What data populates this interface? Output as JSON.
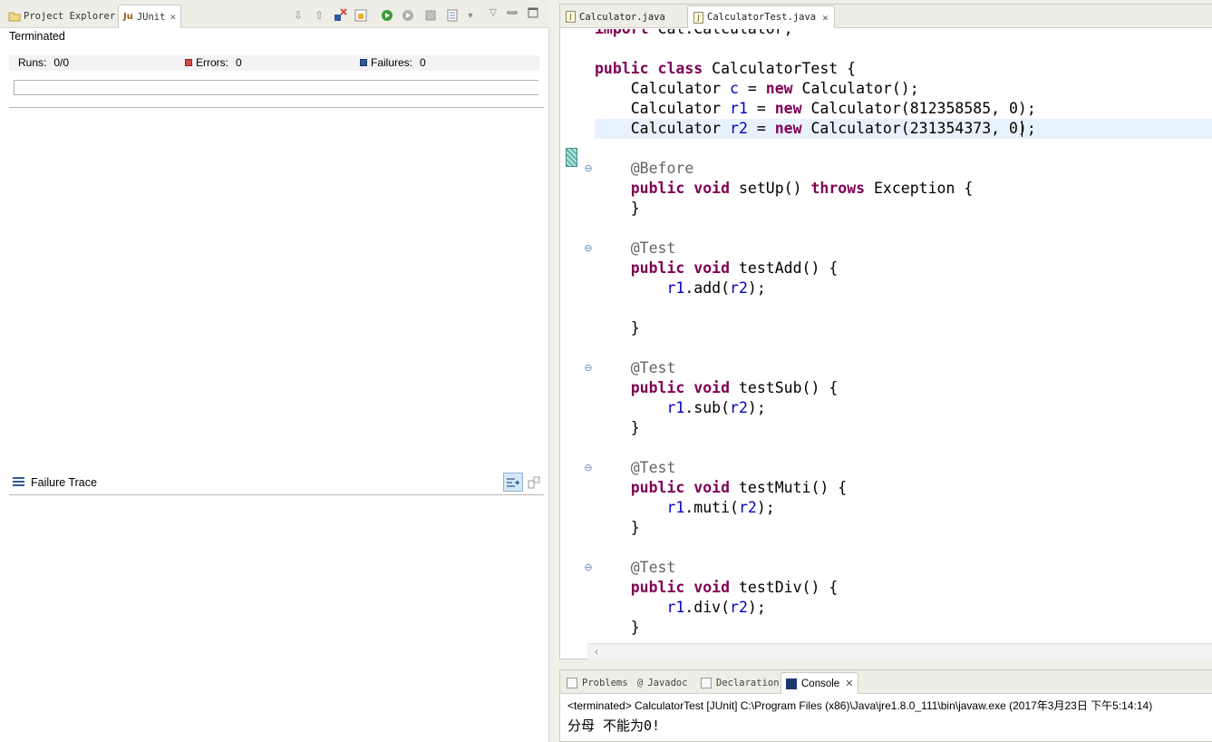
{
  "left_tabs": [
    {
      "label": "Project Explorer",
      "active": false
    },
    {
      "label": "JUnit",
      "active": true,
      "icon_text": "Ju"
    }
  ],
  "junit": {
    "status": "Terminated",
    "runs_label": "Runs:",
    "runs_value": "0/0",
    "errors_label": "Errors:",
    "errors_value": "0",
    "failures_label": "Failures:",
    "failures_value": "0",
    "failure_trace_label": "Failure Trace"
  },
  "editor_tabs": [
    {
      "label": "Calculator.java",
      "active": false
    },
    {
      "label": "CalculatorTest.java",
      "active": true
    }
  ],
  "code_lines": [
    "import Cal.Calculator;",
    "",
    "public class CalculatorTest {",
    "    Calculator c = new Calculator();",
    "    Calculator r1 = new Calculator(812358585, 0);",
    "    Calculator r2 = new Calculator(231354373, 0);",
    "",
    "    @Before",
    "    public void setUp() throws Exception {",
    "    }",
    "",
    "    @Test",
    "    public void testAdd() {",
    "        r1.add(r2);",
    "",
    "    }",
    "",
    "    @Test",
    "    public void testSub() {",
    "        r1.sub(r2);",
    "    }",
    "",
    "    @Test",
    "    public void testMuti() {",
    "        r1.muti(r2);",
    "    }",
    "",
    "    @Test",
    "    public void testDiv() {",
    "        r1.div(r2);",
    "    }"
  ],
  "console_tabs": [
    {
      "label": "Problems",
      "active": false
    },
    {
      "label": "Javadoc",
      "active": false,
      "prefix": "@"
    },
    {
      "label": "Declaration",
      "active": false
    },
    {
      "label": "Console",
      "active": true
    }
  ],
  "console": {
    "terminated_line": "<terminated> CalculatorTest [JUnit] C:\\Program Files (x86)\\Java\\jre1.8.0_111\\bin\\javaw.exe (2017年3月23日 下午5:14:14)",
    "output_line": "分母 不能为0!"
  },
  "colors": {
    "keyword": "#7f0055",
    "field": "#0000c0",
    "annotation": "#646464",
    "current_line": "#e8f2fe",
    "error_icon": "#d34a4a",
    "failure_icon": "#2c5a9a"
  },
  "icons": {
    "toolbar": [
      "next-failure-icon",
      "previous-failure-icon",
      "show-failures-only-icon",
      "scroll-lock-icon",
      "rerun-test-icon",
      "rerun-failed-first-icon",
      "stop-icon",
      "test-run-history-icon",
      "view-menu-icon",
      "minimize-icon",
      "maximize-icon"
    ]
  }
}
